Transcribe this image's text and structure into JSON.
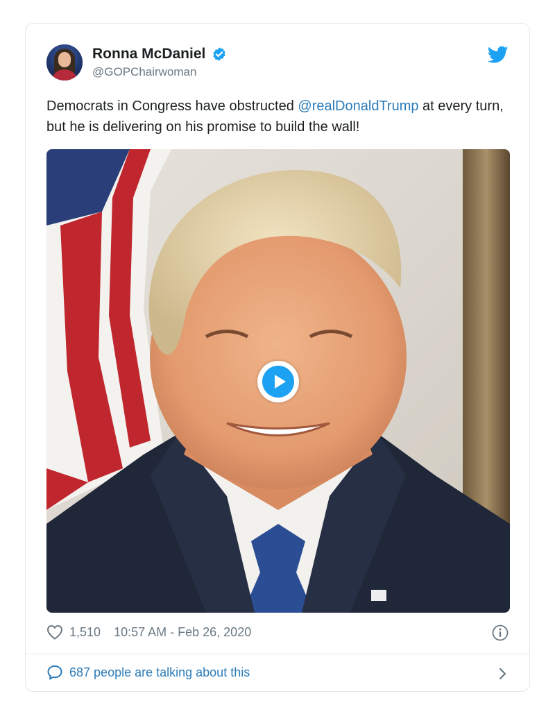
{
  "author": {
    "display_name": "Ronna McDaniel",
    "handle": "@GOPChairwoman",
    "verified": true
  },
  "tweet": {
    "text_before": "Democrats in Congress have obstructed ",
    "mention": "@realDonaldTrump",
    "text_after": " at every turn, but he is delivering on his promise to build the wall!"
  },
  "media": {
    "type": "video",
    "play_icon": "play-icon"
  },
  "meta": {
    "likes": "1,510",
    "timestamp": "10:57 AM - Feb 26, 2020"
  },
  "footer": {
    "conversation_text": "687 people are talking about this"
  },
  "colors": {
    "brand_blue": "#1da1f2",
    "link_blue": "#2b7bb9",
    "meta_gray": "#697882",
    "border": "#e1e8ed"
  },
  "icons": {
    "verified": "verified-badge-icon",
    "brand": "twitter-bird-icon",
    "like": "heart-icon",
    "info": "info-icon",
    "reply": "speech-bubble-icon",
    "more": "chevron-right-icon"
  }
}
